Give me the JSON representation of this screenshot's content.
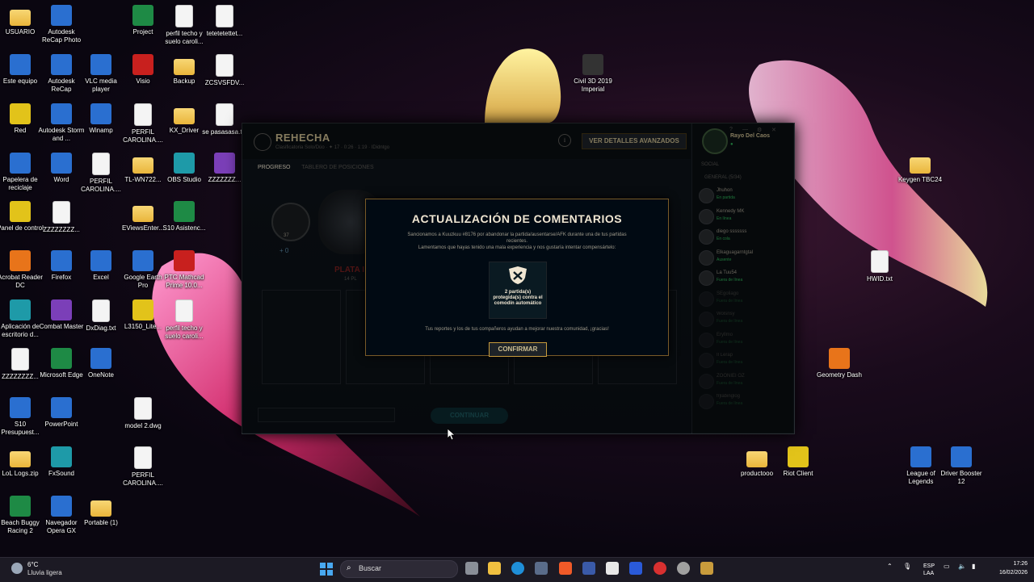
{
  "desktop": {
    "icons": [
      {
        "label": "USUARIO",
        "kind": "folder"
      },
      {
        "label": "Autodesk ReCap Photo",
        "kind": "app"
      },
      {
        "label": "Project",
        "kind": "app"
      },
      {
        "label": "perfil techo y suelo caroli...",
        "kind": "file"
      },
      {
        "label": "tetetetettet...",
        "kind": "file"
      },
      {
        "label": "Este equipo",
        "kind": "app"
      },
      {
        "label": "Autodesk ReCap",
        "kind": "app"
      },
      {
        "label": "VLC media player",
        "kind": "app"
      },
      {
        "label": "Visio",
        "kind": "app"
      },
      {
        "label": "Backup",
        "kind": "folder"
      },
      {
        "label": "ZCSVSFDV...",
        "kind": "file"
      },
      {
        "label": "Civil 3D 2019 Imperial",
        "kind": "app"
      },
      {
        "label": "Red",
        "kind": "app"
      },
      {
        "label": "Autodesk Storm and ...",
        "kind": "app"
      },
      {
        "label": "Winamp",
        "kind": "app"
      },
      {
        "label": "PERFIL CAROLINA....",
        "kind": "file"
      },
      {
        "label": "KX_Driver",
        "kind": "folder"
      },
      {
        "label": "se pasasasa.txt",
        "kind": "file"
      },
      {
        "label": "Papelera de reciclaje",
        "kind": "app"
      },
      {
        "label": "Word",
        "kind": "app"
      },
      {
        "label": "PERFIL CAROLINA....",
        "kind": "file"
      },
      {
        "label": "TL-WN722...",
        "kind": "folder"
      },
      {
        "label": "OBS Studio",
        "kind": "app"
      },
      {
        "label": "ZZZZZZZ...",
        "kind": "app"
      },
      {
        "label": "Keygen TBC24",
        "kind": "folder"
      },
      {
        "label": "Panel de control",
        "kind": "app"
      },
      {
        "label": "ZZZZZZZZ...",
        "kind": "file"
      },
      {
        "label": "EViewsEnter...",
        "kind": "folder"
      },
      {
        "label": "S10 Asistenc...",
        "kind": "app"
      },
      {
        "label": "HWID.txt",
        "kind": "file"
      },
      {
        "label": "Acrobat Reader DC",
        "kind": "app"
      },
      {
        "label": "Firefox",
        "kind": "app"
      },
      {
        "label": "Excel",
        "kind": "app"
      },
      {
        "label": "Google Earth Pro",
        "kind": "app"
      },
      {
        "label": "PTC Mathcad Prime 10.0...",
        "kind": "app"
      },
      {
        "label": "Aplicación de escritorio d...",
        "kind": "app"
      },
      {
        "label": "Combat Master",
        "kind": "app"
      },
      {
        "label": "DxDiag.txt",
        "kind": "file"
      },
      {
        "label": "L3150_Lite...",
        "kind": "app"
      },
      {
        "label": "perfil techo y suelo caroli...",
        "kind": "file"
      },
      {
        "label": "ZZZZZZZZ...",
        "kind": "file"
      },
      {
        "label": "Microsoft Edge",
        "kind": "app"
      },
      {
        "label": "OneNote",
        "kind": "app"
      },
      {
        "label": "Geometry Dash",
        "kind": "app"
      },
      {
        "label": "S10 Presupuest...",
        "kind": "app"
      },
      {
        "label": "PowerPoint",
        "kind": "app"
      },
      {
        "label": "model 2.dwg",
        "kind": "file"
      },
      {
        "label": "LoL Logs.zip",
        "kind": "folder"
      },
      {
        "label": "FxSound",
        "kind": "app"
      },
      {
        "label": "PERFIL CAROLINA....",
        "kind": "file"
      },
      {
        "label": "productooo",
        "kind": "folder"
      },
      {
        "label": "Riot Client",
        "kind": "app"
      },
      {
        "label": "League of Legends",
        "kind": "app"
      },
      {
        "label": "Driver Booster 12",
        "kind": "app"
      },
      {
        "label": "Beach Buggy Racing 2",
        "kind": "app"
      },
      {
        "label": "Navegador Opera GX",
        "kind": "app"
      },
      {
        "label": "Portable (1)",
        "kind": "folder"
      }
    ]
  },
  "client": {
    "title": "REHECHA",
    "subtitle": "Clasificatoria Solo/Dúo · ✦ 17 · 0:26 · 1:19 · IDidntgo",
    "advanced_button": "VER DETALLES AVANZADOS",
    "tabs": [
      "PROGRESO",
      "TABLERO DE POSICIONES"
    ],
    "rank_level": "37",
    "rank_lp": "+ 0",
    "rank_label": "PLATA I",
    "rank_sub": "14 PL",
    "rank_delta": "-16 PL",
    "continue_button": "CONTINUAR",
    "social": {
      "header": "SOCIAL",
      "user_name": "Rayo Del Caos",
      "user_status": "● ",
      "group": "GENERAL (5/34)",
      "friends": [
        {
          "name": "Jhuhon",
          "status": "En partida"
        },
        {
          "name": "Kennedy MK",
          "status": "En línea"
        },
        {
          "name": "diego sssssss",
          "status": "En cola"
        },
        {
          "name": "Elkaguagarntgtal",
          "status": "Ausente"
        },
        {
          "name": "La Tuu54",
          "status": "Fuera de línea"
        },
        {
          "name": "SEgoliago",
          "status": "Fuera de línea"
        },
        {
          "name": "Wolsnsy",
          "status": "Fuera de línea"
        },
        {
          "name": "Eryllmo",
          "status": "Fuera de línea"
        },
        {
          "name": "Il Lerap",
          "status": "Fuera de línea"
        },
        {
          "name": "ZOONIEI OZ",
          "status": "Fuera de línea"
        },
        {
          "name": "frjlabinglog",
          "status": "Fuera de línea"
        }
      ]
    }
  },
  "modal": {
    "title": "ACTUALIZACIÓN DE COMENTARIOS",
    "body_line1": "Sancionamos a Kuuzkuu #8176 por abandonar la partida/ausentarse/AFK durante una de tus partidas recientes.",
    "body_line2": "Lamentamos que hayas tenido una mala experiencia y nos gustaría intentar compensártelo:",
    "reward_text": "2 partida(s) protegida(s) contra el comodín automático",
    "thanks": "Tus reportes y los de tus compañeros ayudan a mejorar nuestra comunidad, ¡gracias!",
    "confirm_button": "CONFIRMAR"
  },
  "taskbar": {
    "weather_temp": "6°C",
    "weather_cond": "Lluvia ligera",
    "search_placeholder": "Buscar",
    "language_line1": "ESP",
    "language_line2": "LAA",
    "time": "17:26",
    "date": "16/02/2026"
  },
  "colors": {
    "lol_gold": "#c89b3c",
    "lol_text": "#f0e6d2",
    "lol_bg": "#010a13",
    "taskbar": "#1c1a24"
  }
}
